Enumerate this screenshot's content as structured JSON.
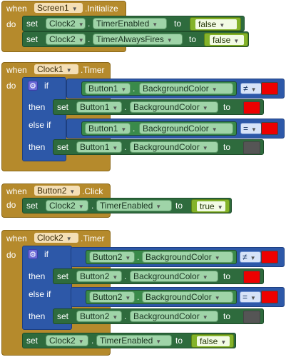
{
  "kw": {
    "when": "when",
    "do": "do",
    "set": "set",
    "to": "to",
    "dot": ".",
    "if": "if",
    "then": "then",
    "else_if": "else if"
  },
  "blocks": {
    "screen_init": {
      "component": "Screen1",
      "event": ".Initialize",
      "set1": {
        "component": "Clock2",
        "property": "TimerEnabled",
        "value": "false"
      },
      "set2": {
        "component": "Clock2",
        "property": "TimerAlwaysFires",
        "value": "false"
      }
    },
    "clock1_timer": {
      "component": "Clock1",
      "event": ".Timer",
      "if_cond": {
        "component": "Button1",
        "property": "BackgroundColor",
        "op": "≠",
        "color": "#ee0000"
      },
      "then_set": {
        "component": "Button1",
        "property": "BackgroundColor",
        "color": "#ee0000"
      },
      "elseif_cond": {
        "component": "Button1",
        "property": "BackgroundColor",
        "op": "=",
        "color": "#ee0000"
      },
      "then2_set": {
        "component": "Button1",
        "property": "BackgroundColor",
        "color": "#555555"
      }
    },
    "button2_click": {
      "component": "Button2",
      "event": ".Click",
      "set": {
        "component": "Clock2",
        "property": "TimerEnabled",
        "value": "true"
      }
    },
    "clock2_timer": {
      "component": "Clock2",
      "event": ".Timer",
      "if_cond": {
        "component": "Button2",
        "property": "BackgroundColor",
        "op": "≠",
        "color": "#ee0000"
      },
      "then_set": {
        "component": "Button2",
        "property": "BackgroundColor",
        "color": "#ee0000"
      },
      "elseif_cond": {
        "component": "Button2",
        "property": "BackgroundColor",
        "op": "=",
        "color": "#ee0000"
      },
      "then2_set": {
        "component": "Button2",
        "property": "BackgroundColor",
        "color": "#555555"
      },
      "final_set": {
        "component": "Clock2",
        "property": "TimerEnabled",
        "value": "false"
      }
    }
  }
}
